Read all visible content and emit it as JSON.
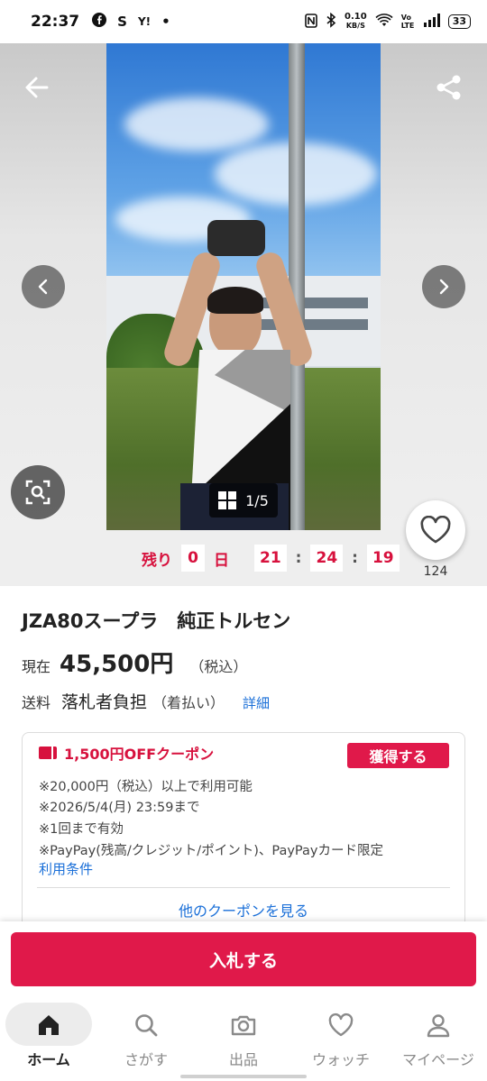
{
  "status_bar": {
    "time": "22:37",
    "app_badge_s": "S",
    "app_badge_y": "Y!",
    "net_speed_value": "0.10",
    "net_speed_unit": "KB/S",
    "volte": "Vo LTE",
    "battery": "33"
  },
  "gallery": {
    "counter": "1/5"
  },
  "countdown": {
    "prefix": "残り",
    "days": "0",
    "days_unit": "日",
    "hours": "21",
    "minutes": "24",
    "seconds": "19",
    "colon": ":"
  },
  "watch": {
    "count": "124"
  },
  "item": {
    "title": "JZA80スープラ　純正トルセン",
    "price_label": "現在",
    "price": "45,500円",
    "price_tax": "（税込）",
    "shipping_label": "送料",
    "shipping_value": "落札者負担",
    "shipping_sub": "（着払い）",
    "shipping_link": "詳細"
  },
  "coupon": {
    "title": "1,500円OFFクーポン",
    "get_button": "獲得する",
    "conditions": [
      "※20,000円（税込）以上で利用可能",
      "※2026/5/4(月) 23:59まで",
      "※1回まで有効",
      "※PayPay(残高/クレジット/ポイント)、PayPayカード限定"
    ],
    "terms_link": "利用条件",
    "more_link": "他のクーポンを見る"
  },
  "bid": {
    "button": "入札する"
  },
  "bottom_nav": {
    "items": [
      {
        "label": "ホーム",
        "icon": "home-icon"
      },
      {
        "label": "さがす",
        "icon": "search-icon"
      },
      {
        "label": "出品",
        "icon": "camera-icon"
      },
      {
        "label": "ウォッチ",
        "icon": "heart-icon"
      },
      {
        "label": "マイページ",
        "icon": "person-icon"
      }
    ]
  },
  "colors": {
    "accent": "#e0194a",
    "link": "#1a6fd8",
    "countdown": "#d7113d"
  }
}
